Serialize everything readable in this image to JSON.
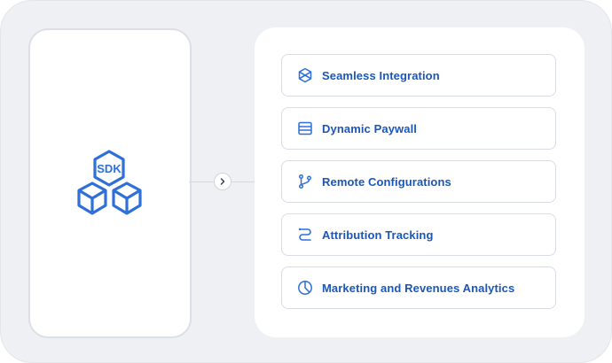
{
  "sdk_label": "SDK",
  "accent_color": "#2f6fd8",
  "features": [
    {
      "label": "Seamless Integration",
      "icon": "integration-icon"
    },
    {
      "label": "Dynamic Paywall",
      "icon": "paywall-icon"
    },
    {
      "label": "Remote Configurations",
      "icon": "git-branch-icon"
    },
    {
      "label": "Attribution Tracking",
      "icon": "route-icon"
    },
    {
      "label": "Marketing and Revenues Analytics",
      "icon": "pie-chart-icon"
    }
  ]
}
